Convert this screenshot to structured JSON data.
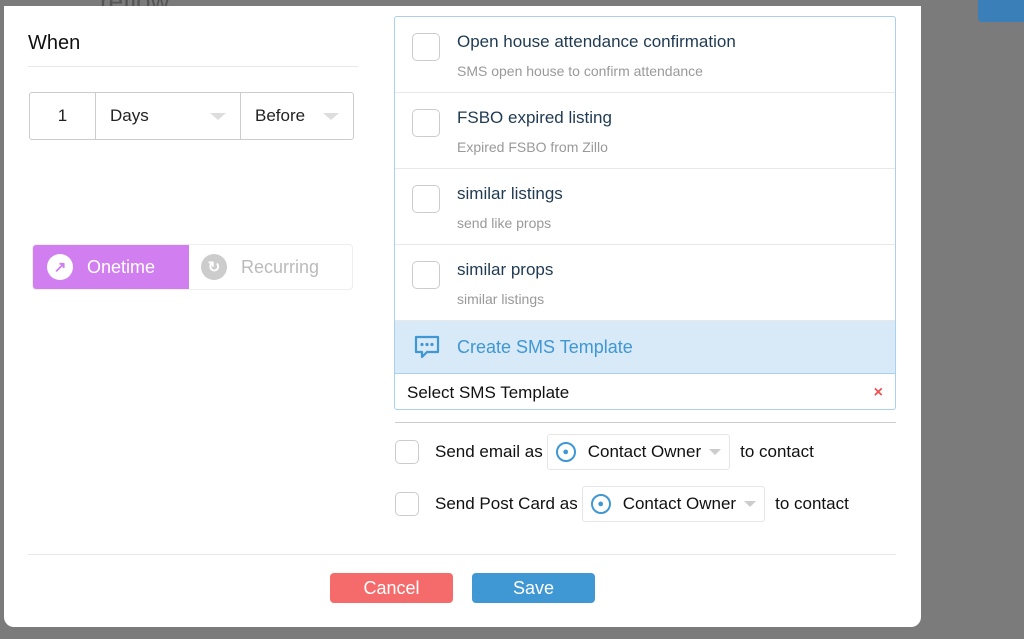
{
  "background": {
    "title_fragment": "reflow"
  },
  "when": {
    "label": "When",
    "amount": "1",
    "unit": "Days",
    "relation": "Before"
  },
  "mode": {
    "onetime": "Onetime",
    "recurring": "Recurring",
    "active": "Onetime",
    "active_color": "#d17ff0"
  },
  "templates": [
    {
      "title": "Open house attendance confirmation",
      "subtitle": "SMS open house to confirm attendance"
    },
    {
      "title": "FSBO expired listing",
      "subtitle": "Expired FSBO from Zillo"
    },
    {
      "title": "similar listings",
      "subtitle": "send like props"
    },
    {
      "title": "similar props",
      "subtitle": "similar listings"
    }
  ],
  "create_template": "Create SMS Template",
  "select_template": {
    "placeholder": "Select SMS Template",
    "clear": "×"
  },
  "email": {
    "label": "Send email as",
    "sender": "Contact Owner",
    "suffix": "to contact"
  },
  "postcard": {
    "label": "Send Post Card as",
    "sender": "Contact Owner",
    "suffix": "to contact"
  },
  "buttons": {
    "cancel": "Cancel",
    "save": "Save"
  }
}
